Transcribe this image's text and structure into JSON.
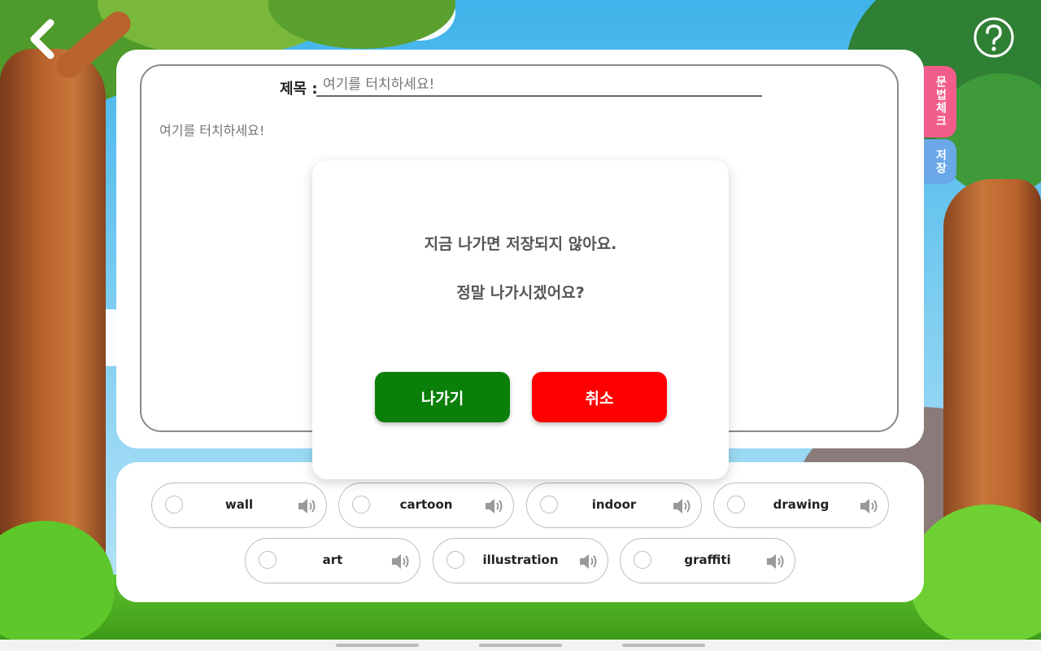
{
  "header": {
    "back_icon": "chevron-left-icon",
    "help_icon": "question-circle-icon"
  },
  "editor": {
    "title_label": "제목 :",
    "title_placeholder": "여기를 터치하세요!",
    "body_placeholder": "여기를 터치하세요!"
  },
  "side_tabs": {
    "grammar_check": "문법체크",
    "save": "저장"
  },
  "words": [
    {
      "label": "wall"
    },
    {
      "label": "cartoon"
    },
    {
      "label": "indoor"
    },
    {
      "label": "drawing"
    },
    {
      "label": "art"
    },
    {
      "label": "illustration"
    },
    {
      "label": "graffiti"
    }
  ],
  "dialog": {
    "line1": "지금 나가면 저장되지 않아요.",
    "line2": "정말 나가시겠어요?",
    "exit_label": "나가기",
    "cancel_label": "취소"
  },
  "colors": {
    "exit_button": "#0a7f0a",
    "cancel_button": "#ff0000",
    "grammar_tab": "#f25c8a",
    "save_tab": "#6aa8e8"
  }
}
